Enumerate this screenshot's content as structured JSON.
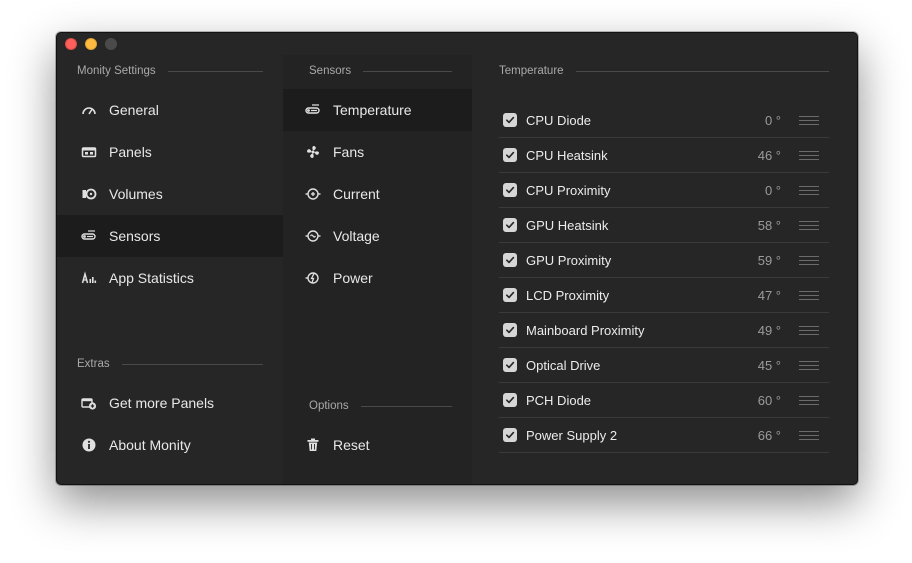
{
  "settings": {
    "section_title": "Monity Settings",
    "items": [
      {
        "label": "General",
        "icon": "gauge-icon"
      },
      {
        "label": "Panels",
        "icon": "panel-icon"
      },
      {
        "label": "Volumes",
        "icon": "volume-drive-icon"
      },
      {
        "label": "Sensors",
        "icon": "sensor-icon",
        "selected": true
      },
      {
        "label": "App Statistics",
        "icon": "app-statistics-icon"
      }
    ]
  },
  "extras": {
    "section_title": "Extras",
    "items": [
      {
        "label": "Get more Panels",
        "icon": "add-panel-icon"
      },
      {
        "label": "About Monity",
        "icon": "info-icon"
      }
    ]
  },
  "sensors": {
    "section_title": "Sensors",
    "items": [
      {
        "label": "Temperature",
        "icon": "thermometer-icon",
        "selected": true
      },
      {
        "label": "Fans",
        "icon": "fan-icon"
      },
      {
        "label": "Current",
        "icon": "current-icon"
      },
      {
        "label": "Voltage",
        "icon": "voltage-icon"
      },
      {
        "label": "Power",
        "icon": "power-icon"
      }
    ]
  },
  "options": {
    "section_title": "Options",
    "items": [
      {
        "label": "Reset",
        "icon": "trash-icon"
      }
    ]
  },
  "temperature": {
    "section_title": "Temperature",
    "rows": [
      {
        "name": "CPU Diode",
        "value": "0 °",
        "checked": true
      },
      {
        "name": "CPU Heatsink",
        "value": "46 °",
        "checked": true
      },
      {
        "name": "CPU Proximity",
        "value": "0 °",
        "checked": true
      },
      {
        "name": "GPU Heatsink",
        "value": "58 °",
        "checked": true
      },
      {
        "name": "GPU Proximity",
        "value": "59 °",
        "checked": true
      },
      {
        "name": "LCD Proximity",
        "value": "47 °",
        "checked": true
      },
      {
        "name": "Mainboard Proximity",
        "value": "49 °",
        "checked": true
      },
      {
        "name": "Optical Drive",
        "value": "45 °",
        "checked": true
      },
      {
        "name": "PCH Diode",
        "value": "60 °",
        "checked": true
      },
      {
        "name": "Power Supply 2",
        "value": "66 °",
        "checked": true
      }
    ]
  },
  "colors": {
    "window_bg": "#262626",
    "selected_bg": "#1c1c1c",
    "close": "#fc605c",
    "minimize": "#fdbc40"
  }
}
